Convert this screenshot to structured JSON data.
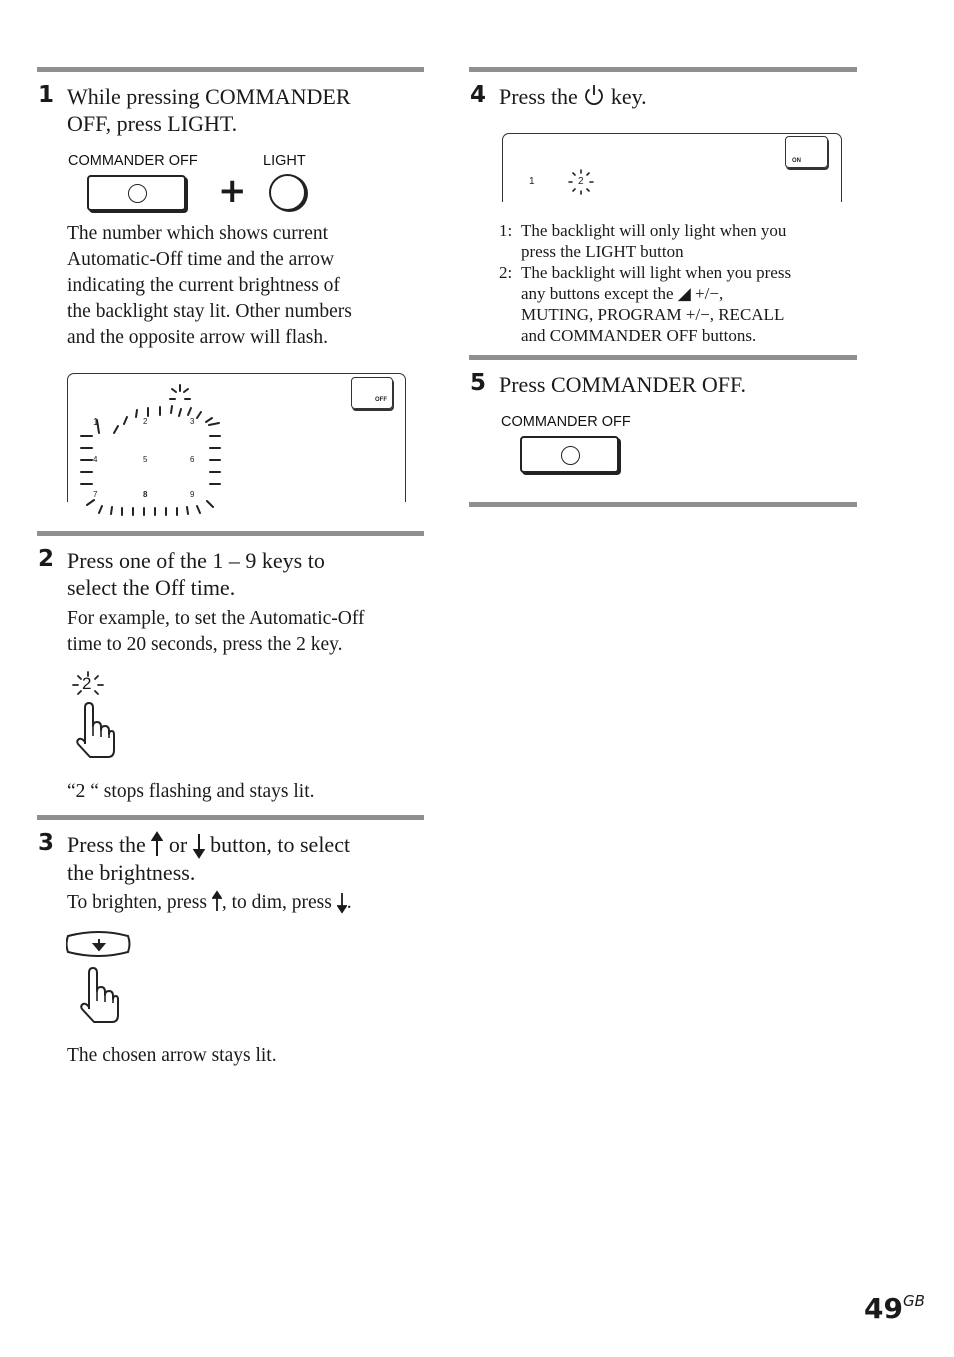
{
  "page": {
    "number": "49",
    "region_suffix": "GB"
  },
  "steps": [
    {
      "number": "1",
      "heading": "While pressing COMMANDER OFF, press LIGHT.",
      "heading_lines": [
        "While pressing COMMANDER",
        "OFF, press LIGHT."
      ],
      "buttons": {
        "commander_off_label": "COMMANDER OFF",
        "plus": "+",
        "light_label": "LIGHT"
      },
      "body_lines": [
        "The number which shows current",
        "Automatic-Off time and the arrow",
        "indicating the current brightness of",
        "the backlight stay lit. Other numbers",
        "and the opposite arrow will flash."
      ],
      "display": {
        "digits": [
          "1",
          "2",
          "3",
          "4",
          "5",
          "6",
          "7",
          "8",
          "9"
        ],
        "off_button_label": "OFF"
      }
    },
    {
      "number": "2",
      "heading_lines": [
        "Press one of the 1 – 9 keys to",
        "select the Off time."
      ],
      "body_lines": [
        "For example, to set the Automatic-Off",
        "time to 20 seconds, press the 2 key."
      ],
      "key_label": "2",
      "result": "“2 “ stops flashing and stays lit."
    },
    {
      "number": "3",
      "heading_parts": {
        "a": "Press the ",
        "b": " or ",
        "c": " button, to select"
      },
      "heading_line2": "the brightness.",
      "body_parts": {
        "a": "To brighten, press ",
        "b": ", to dim, press ",
        "c": "."
      },
      "result": "The chosen arrow stays lit."
    },
    {
      "number": "4",
      "heading_parts": {
        "a": "Press the ",
        "b": " key."
      },
      "display": {
        "left_digit": "1",
        "blink_digit": "2",
        "on_button_label": "ON"
      },
      "notes": [
        {
          "num": "1:",
          "lines": [
            "The backlight will only light when you",
            "press the LIGHT button"
          ]
        },
        {
          "num": "2:",
          "lines": [
            "The backlight will light when you press",
            "any buttons except the ◢ +/−,",
            "MUTING, PROGRAM +/−, RECALL",
            "and COMMANDER OFF buttons."
          ]
        }
      ]
    },
    {
      "number": "5",
      "heading": "Press COMMANDER OFF.",
      "button_label": "COMMANDER OFF"
    }
  ]
}
